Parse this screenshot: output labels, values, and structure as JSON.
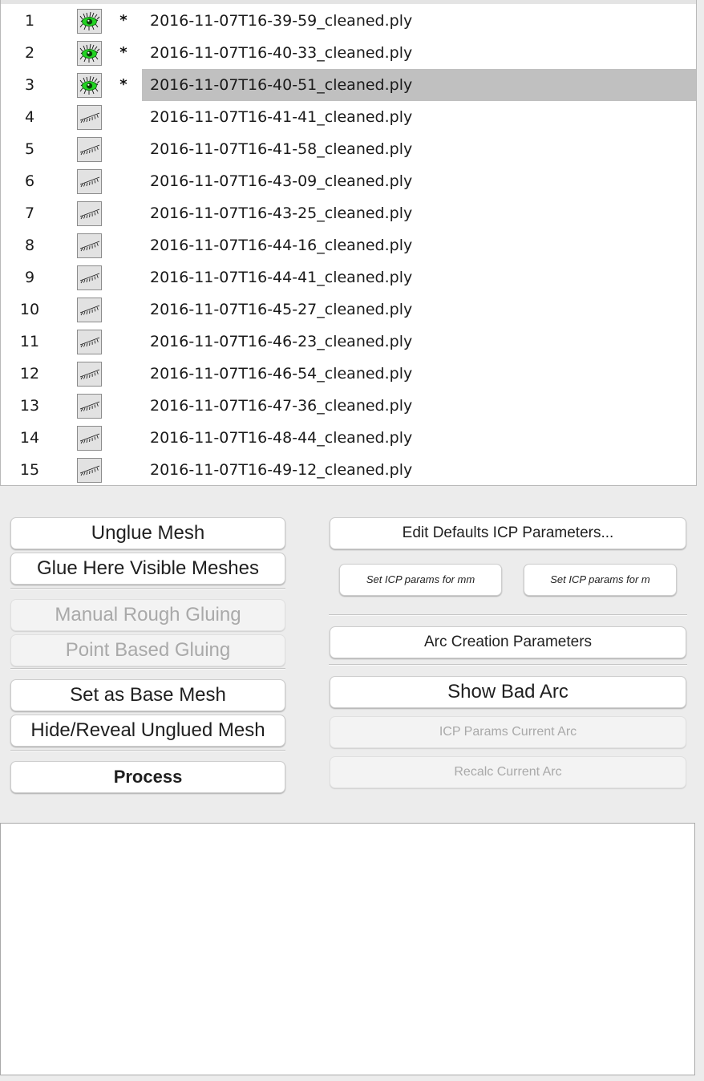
{
  "mesh_list": {
    "rows": [
      {
        "num": "1",
        "visible": true,
        "star": "*",
        "filename": "2016-11-07T16-39-59_cleaned.ply",
        "selected": false
      },
      {
        "num": "2",
        "visible": true,
        "star": "*",
        "filename": "2016-11-07T16-40-33_cleaned.ply",
        "selected": false
      },
      {
        "num": "3",
        "visible": true,
        "star": "*",
        "filename": "2016-11-07T16-40-51_cleaned.ply",
        "selected": true
      },
      {
        "num": "4",
        "visible": false,
        "star": "",
        "filename": "2016-11-07T16-41-41_cleaned.ply",
        "selected": false
      },
      {
        "num": "5",
        "visible": false,
        "star": "",
        "filename": "2016-11-07T16-41-58_cleaned.ply",
        "selected": false
      },
      {
        "num": "6",
        "visible": false,
        "star": "",
        "filename": "2016-11-07T16-43-09_cleaned.ply",
        "selected": false
      },
      {
        "num": "7",
        "visible": false,
        "star": "",
        "filename": "2016-11-07T16-43-25_cleaned.ply",
        "selected": false
      },
      {
        "num": "8",
        "visible": false,
        "star": "",
        "filename": "2016-11-07T16-44-16_cleaned.ply",
        "selected": false
      },
      {
        "num": "9",
        "visible": false,
        "star": "",
        "filename": "2016-11-07T16-44-41_cleaned.ply",
        "selected": false
      },
      {
        "num": "10",
        "visible": false,
        "star": "",
        "filename": "2016-11-07T16-45-27_cleaned.ply",
        "selected": false
      },
      {
        "num": "11",
        "visible": false,
        "star": "",
        "filename": "2016-11-07T16-46-23_cleaned.ply",
        "selected": false
      },
      {
        "num": "12",
        "visible": false,
        "star": "",
        "filename": "2016-11-07T16-46-54_cleaned.ply",
        "selected": false
      },
      {
        "num": "13",
        "visible": false,
        "star": "",
        "filename": "2016-11-07T16-47-36_cleaned.ply",
        "selected": false
      },
      {
        "num": "14",
        "visible": false,
        "star": "",
        "filename": "2016-11-07T16-48-44_cleaned.ply",
        "selected": false
      },
      {
        "num": "15",
        "visible": false,
        "star": "",
        "filename": "2016-11-07T16-49-12_cleaned.ply",
        "selected": false
      }
    ],
    "icons": {
      "visible": "eye-open-icon",
      "hidden": "eye-closed-icon"
    },
    "colors": {
      "selected_row": "#c0c0c0",
      "eye_iris": "#22d322"
    }
  },
  "left_panel": {
    "unglue_mesh": "Unglue Mesh",
    "glue_visible": "Glue Here Visible Meshes",
    "manual_rough_gluing": "Manual Rough Gluing",
    "point_based_gluing": "Point Based Gluing",
    "set_base_mesh": "Set as Base Mesh",
    "hide_reveal": "Hide/Reveal Unglued Mesh",
    "process": "Process"
  },
  "right_panel": {
    "edit_defaults_icp": "Edit Defaults ICP Parameters...",
    "set_icp_mm": "Set ICP params for mm",
    "set_icp_m": "Set ICP params for m",
    "arc_creation": "Arc Creation Parameters",
    "show_bad_arc": "Show Bad Arc",
    "icp_params_current_arc": "ICP Params Current Arc",
    "recalc_current_arc": "Recalc Current Arc"
  },
  "log": {
    "text": ""
  }
}
